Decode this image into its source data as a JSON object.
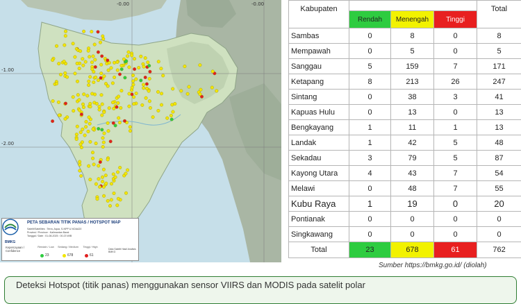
{
  "map": {
    "coords_top": [
      "-0.00",
      "-0.00"
    ],
    "coords_left": [
      "-1.00",
      "-2.00"
    ],
    "legend": {
      "org": "BMKG",
      "title": "PETA SEBARAN TITIK PANAS / HOTSPOT MAP",
      "line1": "Satelit/Satellites : Terra, Aqua, S-NPP & NOAA20",
      "line2": "Provinsi / Province : Kalimantan Barat",
      "line3": "Tanggal / Date : 01-08-2025 : 00.23 WIB",
      "conf_label": "Kepercayaan / Confidence",
      "cat_low": "Rendah / Low",
      "cat_med": "Sedang / Medium",
      "cat_high": "Tinggi / High",
      "count_low": "23",
      "count_med": "678",
      "count_high": "61",
      "scale_note": "Data Satelit Hasil Analisis BMKG",
      "colors": {
        "low": "#2ecc40",
        "med": "#f2e600",
        "high": "#e02020"
      }
    }
  },
  "table": {
    "header": {
      "kabupaten": "Kabupaten",
      "rendah": "Rendah",
      "menengah": "Menengah",
      "tinggi": "Tinggi",
      "total": "Total"
    },
    "header_colors": {
      "rendah": "#2ecc40",
      "menengah": "#f2f200",
      "tinggi": "#e82020"
    },
    "rows": [
      {
        "name": "Sambas",
        "rendah": "0",
        "menengah": "8",
        "tinggi": "0",
        "total": "8"
      },
      {
        "name": "Mempawah",
        "rendah": "0",
        "menengah": "5",
        "tinggi": "0",
        "total": "5"
      },
      {
        "name": "Sanggau",
        "rendah": "5",
        "menengah": "159",
        "tinggi": "7",
        "total": "171"
      },
      {
        "name": "Ketapang",
        "rendah": "8",
        "menengah": "213",
        "tinggi": "26",
        "total": "247"
      },
      {
        "name": "Sintang",
        "rendah": "0",
        "menengah": "38",
        "tinggi": "3",
        "total": "41"
      },
      {
        "name": "Kapuas Hulu",
        "rendah": "0",
        "menengah": "13",
        "tinggi": "0",
        "total": "13"
      },
      {
        "name": "Bengkayang",
        "rendah": "1",
        "menengah": "11",
        "tinggi": "1",
        "total": "13"
      },
      {
        "name": "Landak",
        "rendah": "1",
        "menengah": "42",
        "tinggi": "5",
        "total": "48"
      },
      {
        "name": "Sekadau",
        "rendah": "3",
        "menengah": "79",
        "tinggi": "5",
        "total": "87"
      },
      {
        "name": "Kayong Utara",
        "rendah": "4",
        "menengah": "43",
        "tinggi": "7",
        "total": "54"
      },
      {
        "name": "Melawi",
        "rendah": "0",
        "menengah": "48",
        "tinggi": "7",
        "total": "55"
      },
      {
        "name": "Kubu Raya",
        "rendah": "1",
        "menengah": "19",
        "tinggi": "0",
        "total": "20"
      },
      {
        "name": "Pontianak",
        "rendah": "0",
        "menengah": "0",
        "tinggi": "0",
        "total": "0"
      },
      {
        "name": "Singkawang",
        "rendah": "0",
        "menengah": "0",
        "tinggi": "0",
        "total": "0"
      }
    ],
    "total": {
      "label": "Total",
      "rendah": "23",
      "menengah": "678",
      "tinggi": "61",
      "total": "762"
    }
  },
  "source": "Sumber https://bmkg.go.id/ (diolah)",
  "caption": "Deteksi Hotspot (titik panas) menggunakan sensor VIIRS dan MODIS pada satelit polar"
}
